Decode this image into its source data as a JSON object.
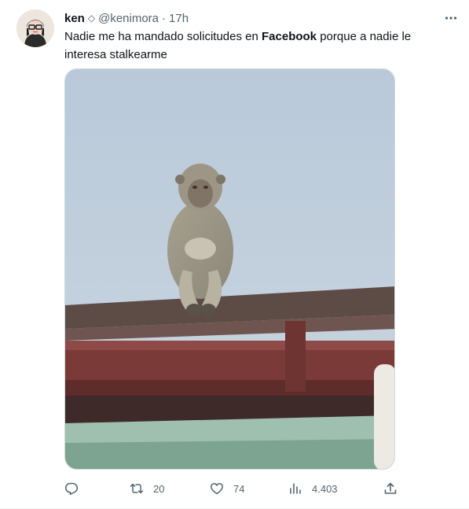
{
  "tweet": {
    "author_name": "ken",
    "verified_glyph": "◇",
    "handle": "@kenimora",
    "separator": "·",
    "time": "17h",
    "text_before": "Nadie me ha mandado solicitudes en ",
    "text_bold": "Facebook",
    "text_after": " porque a nadie le interesa stalkearme"
  },
  "actions": {
    "reply_count": "",
    "retweet_count": "20",
    "like_count": "74",
    "views_count": "4.403"
  },
  "icons": {
    "more": "more-icon",
    "reply": "reply-icon",
    "retweet": "retweet-icon",
    "like": "heart-icon",
    "views": "views-icon",
    "share": "share-icon"
  },
  "colors": {
    "text_primary": "#0f1419",
    "text_secondary": "#536471",
    "border": "#cfd9de"
  }
}
